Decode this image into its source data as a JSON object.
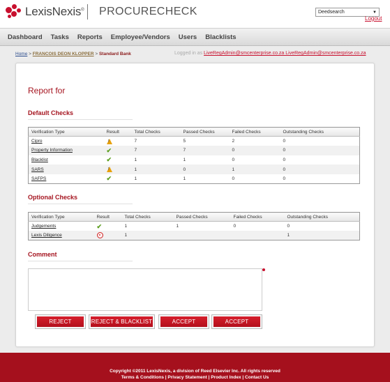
{
  "header": {
    "logo_text": "LexisNexis",
    "logo_mark": "®",
    "brand": "PROCURECHECK",
    "select_value": "Deedsearch",
    "logout": "Logout"
  },
  "nav": [
    "Dashboard",
    "Tasks",
    "Reports",
    "Employee/Vendors",
    "Users",
    "Blacklists"
  ],
  "breadcrumb": {
    "home": "Home",
    "sep1": " > ",
    "vendor": "FRANCOIS DEON KLOPPER",
    "sep2": " > ",
    "current": "Standard Bank"
  },
  "logged_in": {
    "prefix": "Logged in as ",
    "email": "LiveRegAdmin@smcenterprise.co.za LiveRegAdmin@smcenterprise.co.za"
  },
  "report_title": "Report for",
  "default_checks": {
    "title": "Default Checks",
    "headers": [
      "Verification Type",
      "Result",
      "Total Checks",
      "Passed Checks",
      "Failed Checks",
      "Outstanding Checks"
    ],
    "rows": [
      {
        "name": "Cipro",
        "result": "warning-icon",
        "total": "7",
        "passed": "5",
        "failed": "2",
        "outstanding": "0"
      },
      {
        "name": "Property Information",
        "result": "check-icon",
        "total": "7",
        "passed": "7",
        "failed": "0",
        "outstanding": "0"
      },
      {
        "name": "Blacklist",
        "result": "check-icon",
        "total": "1",
        "passed": "1",
        "failed": "0",
        "outstanding": "0"
      },
      {
        "name": "SARS",
        "result": "warning-icon",
        "total": "1",
        "passed": "0",
        "failed": "1",
        "outstanding": "0"
      },
      {
        "name": "SAFPS",
        "result": "check-icon",
        "total": "1",
        "passed": "1",
        "failed": "0",
        "outstanding": "0"
      }
    ]
  },
  "optional_checks": {
    "title": "Optional Checks",
    "headers": [
      "Verification Type",
      "Result",
      "Total Checks",
      "Passed Checks",
      "Failed Checks",
      "Outstanding Checks"
    ],
    "rows": [
      {
        "name": "Judgements",
        "result": "check-icon",
        "total": "1",
        "passed": "1",
        "failed": "0",
        "outstanding": "0"
      },
      {
        "name": "Lexis Diligence",
        "result": "error-icon",
        "total": "1",
        "passed": "",
        "failed": "",
        "outstanding": "1"
      }
    ]
  },
  "comment": {
    "title": "Comment",
    "value": ""
  },
  "buttons": [
    "REJECT",
    "REJECT & BLACKLIST",
    "ACCEPT",
    "ACCEPT"
  ],
  "footer": {
    "copyright": "Copyright ©2011 LexisNexis, a division of Reed Elsevier Inc. All rights reserved",
    "links": [
      "Terms & Conditions",
      "Privacy Statement",
      "Product Index",
      "Contact Us"
    ],
    "link_sep": " | "
  },
  "colors": {
    "brand_red": "#a5141f",
    "check_green": "#5b9e1e",
    "warning_amber": "#e8a10c"
  }
}
